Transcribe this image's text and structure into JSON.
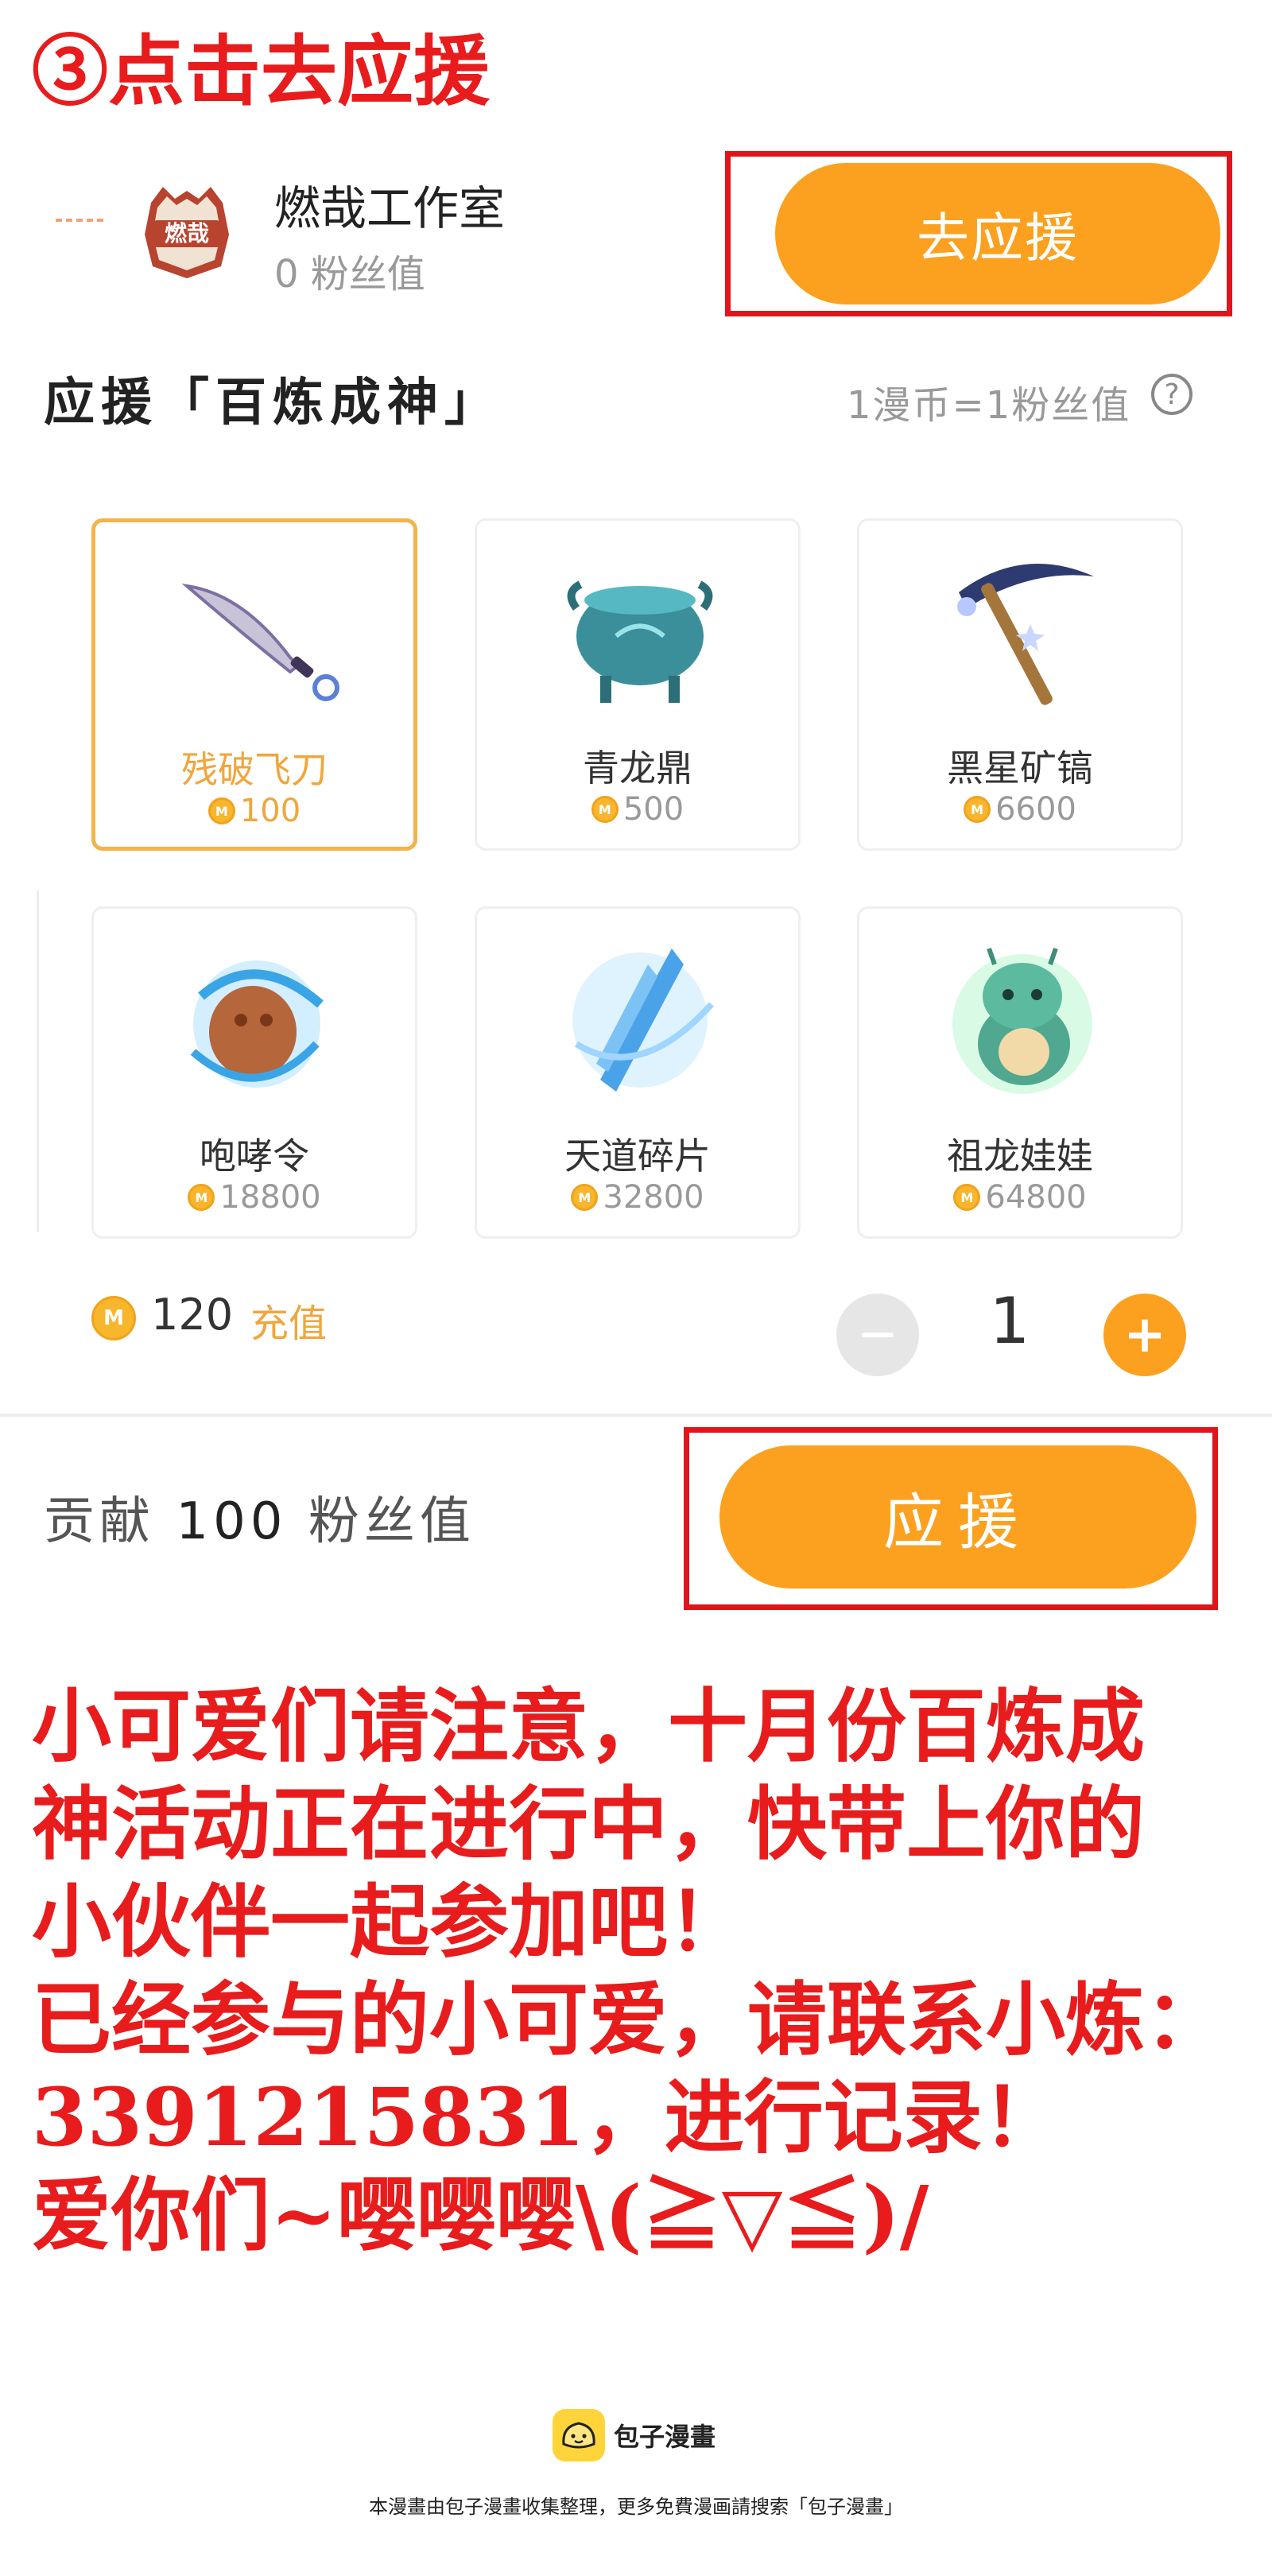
{
  "step_title": "③点击去应援",
  "studio": {
    "name": "燃哉工作室",
    "fans": "0 粉丝值",
    "logo_text": "燃哉",
    "go_support_label": "去应援"
  },
  "section": {
    "title": "应援「百炼成神」",
    "rate": "1漫币=1粉丝值",
    "help": "?"
  },
  "gifts": [
    {
      "name": "残破飞刀",
      "price": "100",
      "selected": true,
      "icon": "flying-knife-icon"
    },
    {
      "name": "青龙鼎",
      "price": "500",
      "selected": false,
      "icon": "dragon-cauldron-icon"
    },
    {
      "name": "黑星矿镐",
      "price": "6600",
      "selected": false,
      "icon": "pickaxe-icon"
    },
    {
      "name": "咆哮令",
      "price": "18800",
      "selected": false,
      "icon": "roar-token-icon"
    },
    {
      "name": "天道碎片",
      "price": "32800",
      "selected": false,
      "icon": "heaven-shard-icon"
    },
    {
      "name": "祖龙娃娃",
      "price": "64800",
      "selected": false,
      "icon": "dragon-doll-icon"
    }
  ],
  "coin_symbol": "M",
  "balance": {
    "amount": "120",
    "recharge_label": "充值"
  },
  "quantity": {
    "value": "1",
    "plus": "+"
  },
  "contribute": {
    "prefix": "贡献",
    "amount": "100",
    "suffix": "粉丝值"
  },
  "support_label": "应援",
  "notice_lines": [
    "小可爱们请注意，十月份百炼成",
    "神活动正在进行中，快带上你的",
    "小伙伴一起参加吧！",
    "已经参与的小可爱，请联系小炼：",
    "3391215831，进行记录！",
    "爱你们~嘤嘤嘤\\(≧▽≦)/"
  ],
  "footer": {
    "brand": "包子漫畫",
    "note": "本漫畫由包子漫畫收集整理，更多免費漫画請搜索「包子漫畫」"
  },
  "colors": {
    "accent": "#fba11f",
    "red": "#e81c1c",
    "selected_border": "#f3b449"
  }
}
